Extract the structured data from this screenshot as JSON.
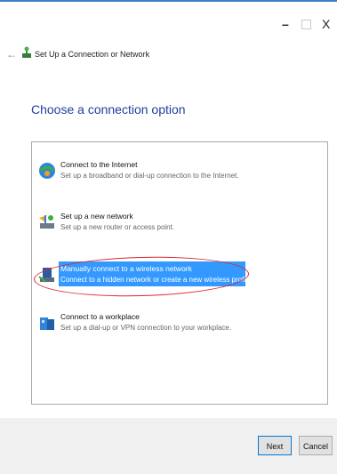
{
  "window": {
    "title": "Set Up a Connection or Network",
    "controls": {
      "minimize": "–",
      "maximize": "",
      "close": "X"
    }
  },
  "nav": {
    "back_icon": "back-arrow-icon"
  },
  "heading": "Choose a connection option",
  "options": [
    {
      "title": "Connect to the Internet",
      "description": "Set up a broadband or dial-up connection to the Internet.",
      "icon": "globe-network-icon"
    },
    {
      "title": "Set up a new network",
      "description": "Set up a new router or access point.",
      "icon": "router-icon"
    },
    {
      "title": "Manually connect to a wireless network",
      "description": "Connect to a hidden network or create a new wireless profile.",
      "icon": "wireless-network-icon",
      "selected": true
    },
    {
      "title": "Connect to a workplace",
      "description": "Set up a dial-up or VPN connection to your workplace.",
      "icon": "workplace-vpn-icon"
    }
  ],
  "buttons": {
    "next": "Next",
    "cancel": "Cancel"
  },
  "colors": {
    "heading": "#1e3f9c",
    "selection": "#3399ff",
    "annotation": "#e0242c"
  }
}
